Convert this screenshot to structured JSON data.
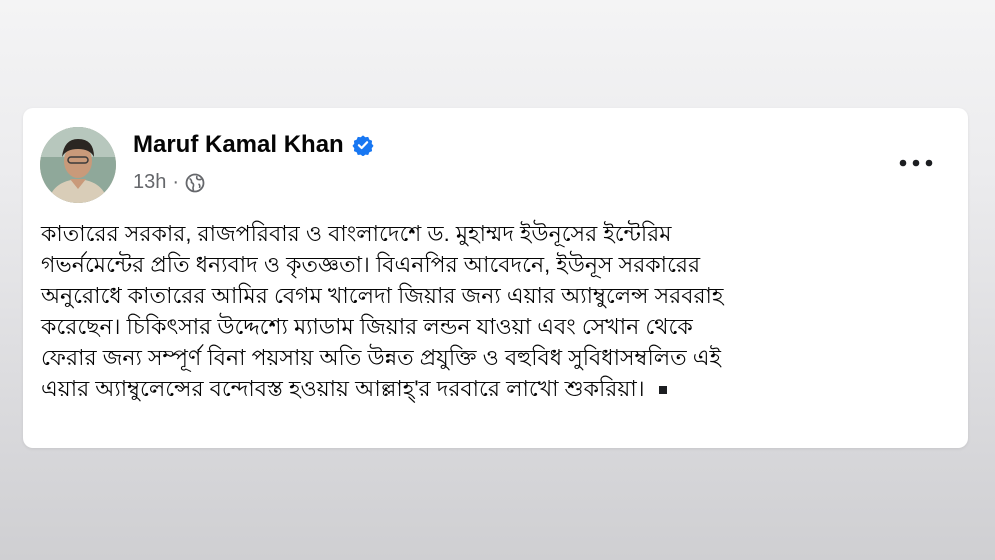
{
  "post": {
    "author": {
      "name": "Maruf Kamal Khan",
      "verified": true,
      "avatar_icon": "profile-photo"
    },
    "time": "13h",
    "separator": "·",
    "audience_icon": "globe-icon",
    "more_icon": "more-options-icon",
    "body_lines": [
      "কাতারের সরকার, রাজপরিবার ও বাংলাদেশে ড. মুহাম্মদ ইউনূসের ইন্টেরিম",
      "গভর্নমেন্টের প্রতি ধন্যবাদ ও কৃতজ্ঞতা। বিএনপির আবেদনে, ইউনূস সরকারের",
      "অনুরোধে কাতারের আমির বেগম খালেদা জিয়ার জন্য এয়ার অ্যাম্বুলেন্স সরবরাহ",
      "করেছেন। চিকিৎসার উদ্দেশ্যে ম্যাডাম জিয়ার লন্ডন যাওয়া এবং সেখান থেকে",
      "ফেরার জন্য সম্পূর্ণ বিনা পয়সায় অতি উন্নত প্রযুক্তি ও বহুবিধ সুবিধাসম্বলিত এই",
      "এয়ার অ্যাম্বুলেন্সের বন্দোবস্ত হওয়ায় আল্লাহ্‌'র দরবারে লাখো শুকরিয়া।"
    ]
  },
  "colors": {
    "verified_badge": "#1877f2",
    "meta_text": "#65676b",
    "body_text": "#050505"
  }
}
